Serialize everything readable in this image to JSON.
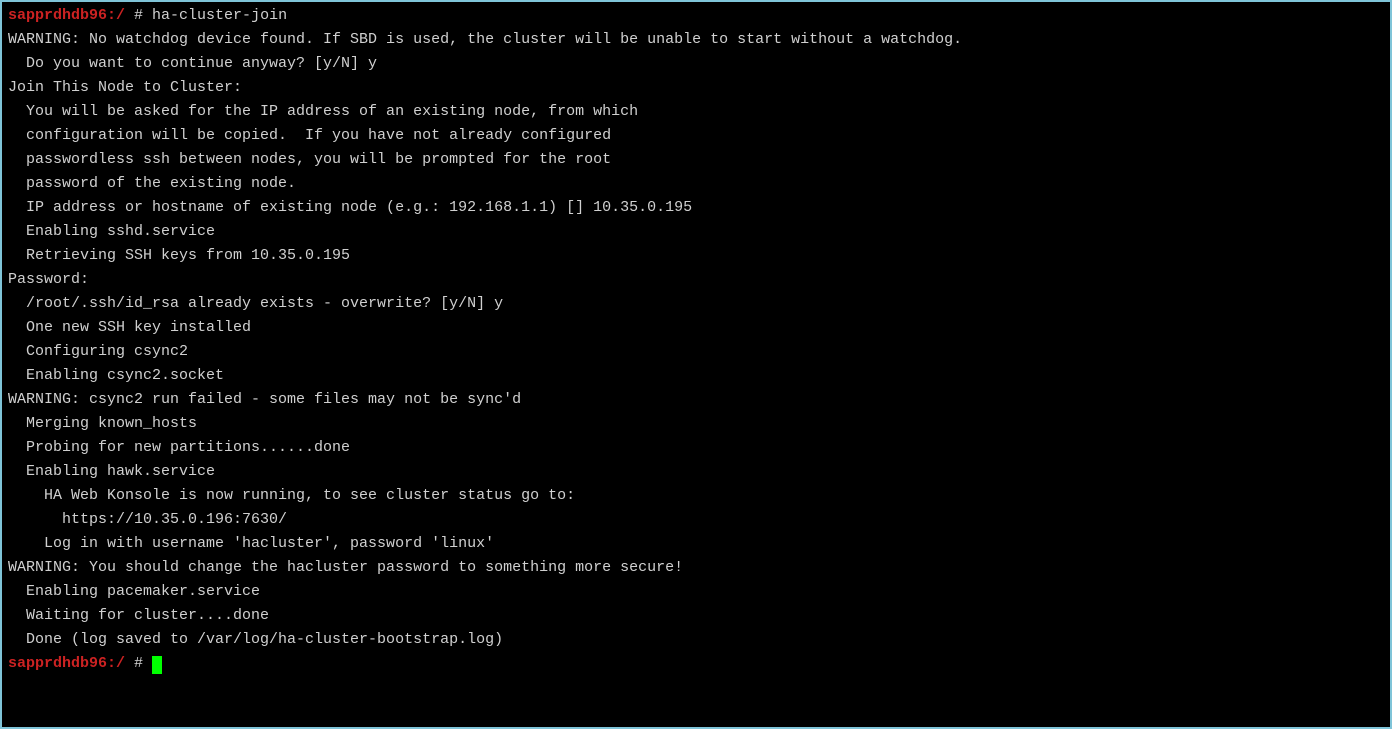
{
  "prompt1_host": "sapprdhdb96:/",
  "prompt1_hash": " # ",
  "command1": "ha-cluster-join",
  "l1": "WARNING: No watchdog device found. If SBD is used, the cluster will be unable to start without a watchdog.",
  "l2": "  Do you want to continue anyway? [y/N] y",
  "l3": "",
  "l4": "Join This Node to Cluster:",
  "l5": "  You will be asked for the IP address of an existing node, from which",
  "l6": "  configuration will be copied.  If you have not already configured",
  "l7": "  passwordless ssh between nodes, you will be prompted for the root",
  "l8": "  password of the existing node.",
  "l9": "",
  "l10": "  IP address or hostname of existing node (e.g.: 192.168.1.1) [] 10.35.0.195",
  "l11": "  Enabling sshd.service",
  "l12": "  Retrieving SSH keys from 10.35.0.195",
  "l13": "Password:",
  "l14": "  /root/.ssh/id_rsa already exists - overwrite? [y/N] y",
  "l15": "  One new SSH key installed",
  "l16": "  Configuring csync2",
  "l17": "  Enabling csync2.socket",
  "l18": "WARNING: csync2 run failed - some files may not be sync'd",
  "l19": "  Merging known_hosts",
  "l20": "  Probing for new partitions......done",
  "l21": "  Enabling hawk.service",
  "l22": "    HA Web Konsole is now running, to see cluster status go to:",
  "l23": "      https://10.35.0.196:7630/",
  "l24": "    Log in with username 'hacluster', password 'linux'",
  "l25": "WARNING: You should change the hacluster password to something more secure!",
  "l26": "  Enabling pacemaker.service",
  "l27": "  Waiting for cluster....done",
  "l28": "  Done (log saved to /var/log/ha-cluster-bootstrap.log)",
  "prompt2_host": "sapprdhdb96:/",
  "prompt2_hash": " # "
}
